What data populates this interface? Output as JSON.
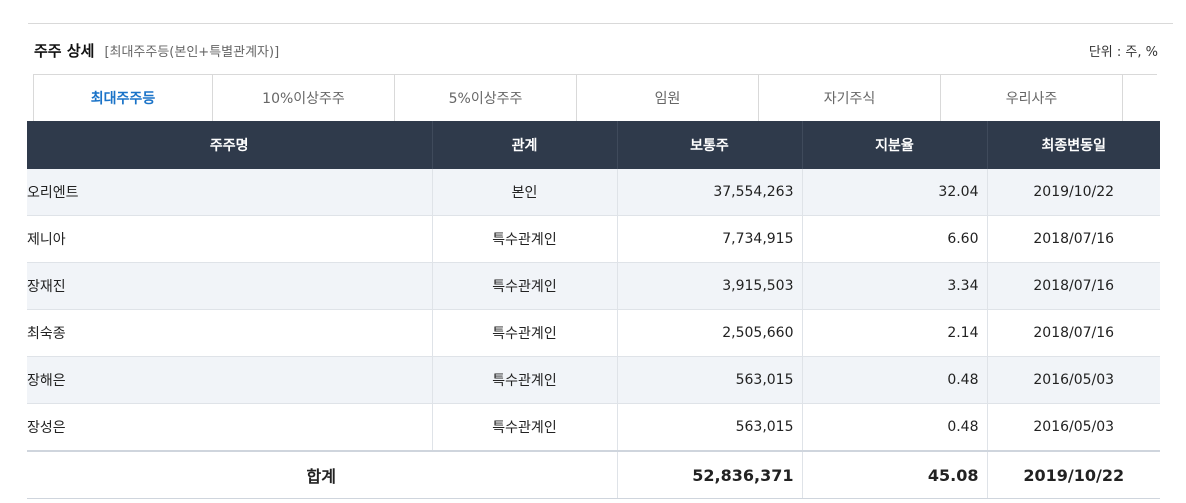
{
  "header": {
    "title": "주주 상세",
    "subtitle": "[최대주주등(본인+특별관계자)]",
    "unit": "단위 : 주, %"
  },
  "tabs": [
    {
      "label": "최대주주등",
      "active": true
    },
    {
      "label": "10%이상주주",
      "active": false
    },
    {
      "label": "5%이상주주",
      "active": false
    },
    {
      "label": "임원",
      "active": false
    },
    {
      "label": "자기주식",
      "active": false
    },
    {
      "label": "우리사주",
      "active": false
    }
  ],
  "table": {
    "columns": [
      "주주명",
      "관계",
      "보통주",
      "지분율",
      "최종변동일"
    ],
    "rows": [
      {
        "name": "오리엔트",
        "relation": "본인",
        "shares": "37,554,263",
        "ratio": "32.04",
        "date": "2019/10/22"
      },
      {
        "name": "제니아",
        "relation": "특수관계인",
        "shares": "7,734,915",
        "ratio": "6.60",
        "date": "2018/07/16"
      },
      {
        "name": "장재진",
        "relation": "특수관계인",
        "shares": "3,915,503",
        "ratio": "3.34",
        "date": "2018/07/16"
      },
      {
        "name": "최숙종",
        "relation": "특수관계인",
        "shares": "2,505,660",
        "ratio": "2.14",
        "date": "2018/07/16"
      },
      {
        "name": "장해은",
        "relation": "특수관계인",
        "shares": "563,015",
        "ratio": "0.48",
        "date": "2016/05/03"
      },
      {
        "name": "장성은",
        "relation": "특수관계인",
        "shares": "563,015",
        "ratio": "0.48",
        "date": "2016/05/03"
      }
    ],
    "total": {
      "label": "합계",
      "shares": "52,836,371",
      "ratio": "45.08",
      "date": "2019/10/22"
    }
  },
  "colors": {
    "header_bg": "#2f3a4b",
    "active_tab": "#1a73c8",
    "row_alt": "#f1f4f8"
  }
}
